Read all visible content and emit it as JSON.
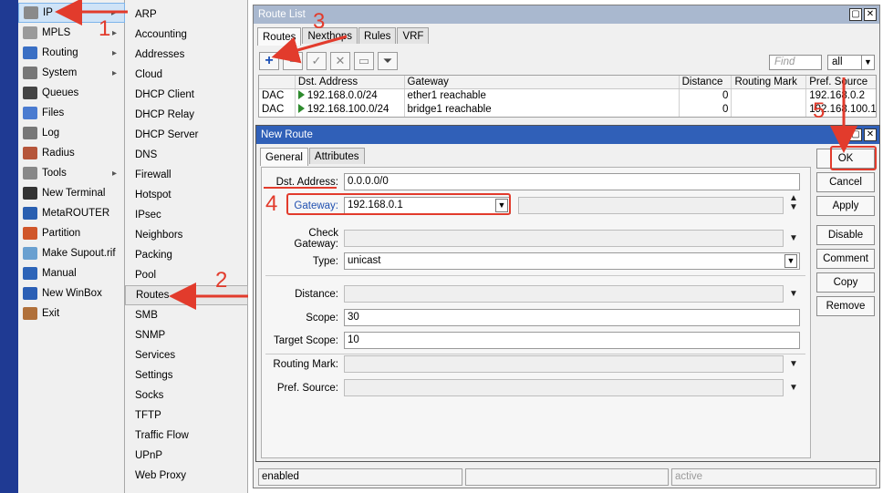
{
  "main_menu": [
    {
      "label": "IP",
      "icon": "ip-icon",
      "submenu": true,
      "selected": true
    },
    {
      "label": "MPLS",
      "icon": "mpls-icon",
      "submenu": true
    },
    {
      "label": "Routing",
      "icon": "routing-icon",
      "submenu": true
    },
    {
      "label": "System",
      "icon": "system-gear-icon",
      "submenu": true
    },
    {
      "label": "Queues",
      "icon": "queues-icon",
      "submenu": false
    },
    {
      "label": "Files",
      "icon": "files-icon",
      "submenu": false
    },
    {
      "label": "Log",
      "icon": "log-icon",
      "submenu": false
    },
    {
      "label": "Radius",
      "icon": "radius-icon",
      "submenu": false
    },
    {
      "label": "Tools",
      "icon": "tools-icon",
      "submenu": true
    },
    {
      "label": "New Terminal",
      "icon": "terminal-icon",
      "submenu": false
    },
    {
      "label": "MetaROUTER",
      "icon": "metarouter-icon",
      "submenu": false
    },
    {
      "label": "Partition",
      "icon": "partition-icon",
      "submenu": false
    },
    {
      "label": "Make Supout.rif",
      "icon": "supout-icon",
      "submenu": false
    },
    {
      "label": "Manual",
      "icon": "manual-icon",
      "submenu": false
    },
    {
      "label": "New WinBox",
      "icon": "winbox-icon",
      "submenu": false
    },
    {
      "label": "Exit",
      "icon": "exit-icon",
      "submenu": false
    }
  ],
  "ip_submenu": [
    "ARP",
    "Accounting",
    "Addresses",
    "Cloud",
    "DHCP Client",
    "DHCP Relay",
    "DHCP Server",
    "DNS",
    "Firewall",
    "Hotspot",
    "IPsec",
    "Neighbors",
    "Packing",
    "Pool",
    "Routes",
    "SMB",
    "SNMP",
    "Services",
    "Settings",
    "Socks",
    "TFTP",
    "Traffic Flow",
    "UPnP",
    "Web Proxy"
  ],
  "route_list": {
    "title": "Route List",
    "tabs": [
      "Routes",
      "Nexthops",
      "Rules",
      "VRF"
    ],
    "find_placeholder": "Find",
    "filter_value": "all",
    "columns": [
      "",
      "Dst. Address",
      "Gateway",
      "Distance",
      "Routing Mark",
      "Pref. Source"
    ],
    "rows": [
      {
        "flags": "DAC",
        "dst": "192.168.0.0/24",
        "gateway": "ether1 reachable",
        "distance": "0",
        "routing_mark": "",
        "pref_source": "192.168.0.2"
      },
      {
        "flags": "DAC",
        "dst": "192.168.100.0/24",
        "gateway": "bridge1 reachable",
        "distance": "0",
        "routing_mark": "",
        "pref_source": "192.168.100.1"
      }
    ],
    "status_left": "enabled",
    "status_right": "active"
  },
  "new_route": {
    "title": "New Route",
    "tabs": [
      "General",
      "Attributes"
    ],
    "fields": {
      "dst_label": "Dst. Address:",
      "dst_value": "0.0.0.0/0",
      "gateway_label": "Gateway:",
      "gateway_value": "192.168.0.1",
      "check_gateway_label": "Check Gateway:",
      "type_label": "Type:",
      "type_value": "unicast",
      "distance_label": "Distance:",
      "scope_label": "Scope:",
      "scope_value": "30",
      "target_scope_label": "Target Scope:",
      "target_scope_value": "10",
      "routing_mark_label": "Routing Mark:",
      "pref_source_label": "Pref. Source:"
    },
    "buttons": [
      "OK",
      "Cancel",
      "Apply",
      "Disable",
      "Comment",
      "Copy",
      "Remove"
    ]
  },
  "annotations": [
    "1",
    "2",
    "3",
    "4",
    "5"
  ],
  "colors": {
    "annotation": "#e23b2c",
    "accent_blue": "#1f3a93",
    "dialog_title": "#3060b8"
  }
}
